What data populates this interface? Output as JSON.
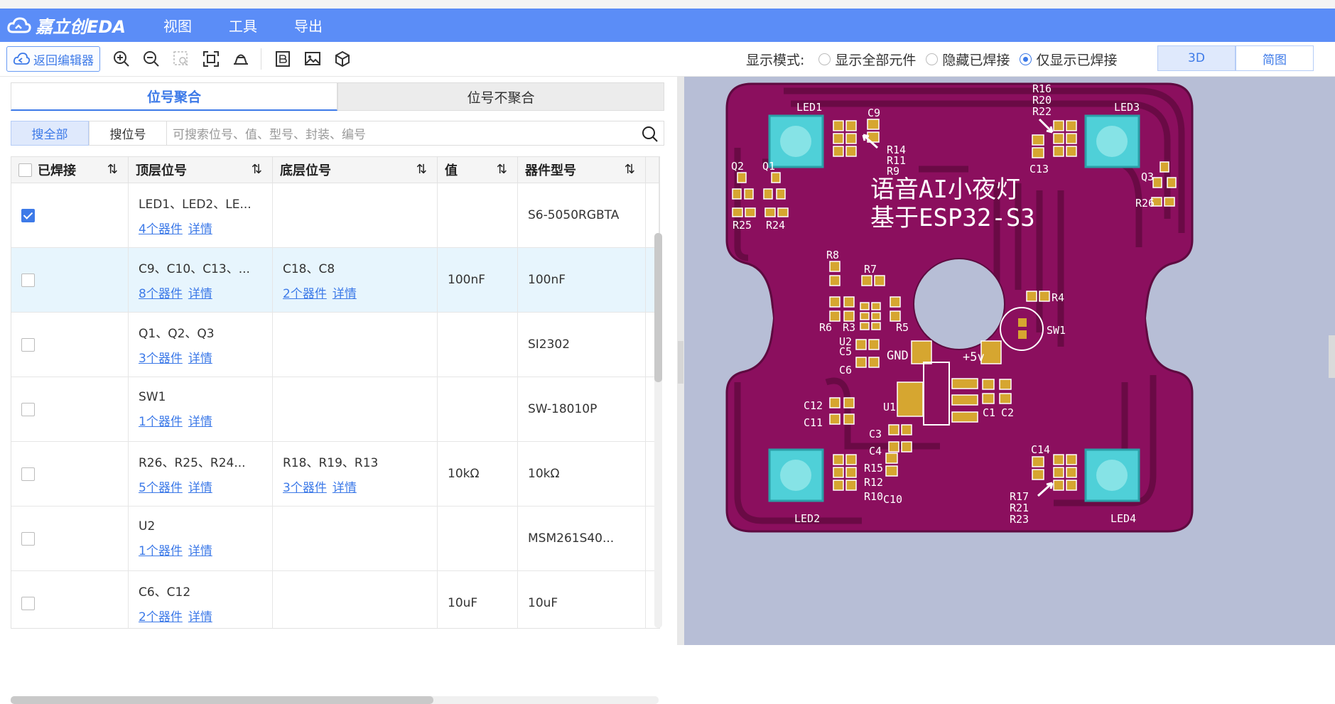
{
  "app": {
    "logo_text": "嘉立创EDA",
    "menu": [
      "视图",
      "工具",
      "导出"
    ]
  },
  "toolbar": {
    "back_label": "返回编辑器",
    "display_mode_label": "显示模式:",
    "modes": [
      "显示全部元件",
      "隐藏已焊接",
      "仅显示已焊接"
    ],
    "selected_mode": "仅显示已焊接",
    "view_buttons": [
      "3D",
      "简图"
    ],
    "active_view": "3D"
  },
  "tabs": [
    "位号聚合",
    "位号不聚合"
  ],
  "search": {
    "buttons": [
      "搜全部",
      "搜位号"
    ],
    "placeholder": "可搜索位号、值、型号、封装、编号"
  },
  "table": {
    "headers": [
      "已焊接",
      "顶层位号",
      "底层位号",
      "值",
      "器件型号"
    ],
    "rows": [
      {
        "checked": true,
        "top": "LED1、LED2、LE...",
        "top_count": "4个器件",
        "top_detail": "详情",
        "bottom": "",
        "bottom_count": "",
        "bottom_detail": "",
        "value": "",
        "model": "S6-5050RGBTA"
      },
      {
        "checked": false,
        "top": "C9、C10、C13、...",
        "top_count": "8个器件",
        "top_detail": "详情",
        "bottom": "C18、C8",
        "bottom_count": "2个器件",
        "bottom_detail": "详情",
        "value": "100nF",
        "model": "100nF"
      },
      {
        "checked": false,
        "top": "Q1、Q2、Q3",
        "top_count": "3个器件",
        "top_detail": "详情",
        "bottom": "",
        "bottom_count": "",
        "bottom_detail": "",
        "value": "",
        "model": "SI2302"
      },
      {
        "checked": false,
        "top": "SW1",
        "top_count": "1个器件",
        "top_detail": "详情",
        "bottom": "",
        "bottom_count": "",
        "bottom_detail": "",
        "value": "",
        "model": "SW-18010P"
      },
      {
        "checked": false,
        "top": "R26、R25、R24...",
        "top_count": "5个器件",
        "top_detail": "详情",
        "bottom": "R18、R19、R13",
        "bottom_count": "3个器件",
        "bottom_detail": "详情",
        "value": "10kΩ",
        "model": "10kΩ"
      },
      {
        "checked": false,
        "top": "U2",
        "top_count": "1个器件",
        "top_detail": "详情",
        "bottom": "",
        "bottom_count": "",
        "bottom_detail": "",
        "value": "",
        "model": "MSM261S40..."
      },
      {
        "checked": false,
        "top": "C6、C12",
        "top_count": "2个器件",
        "top_detail": "详情",
        "bottom": "",
        "bottom_count": "",
        "bottom_detail": "",
        "value": "10uF",
        "model": "10uF"
      }
    ]
  },
  "pcb": {
    "title_line1": "语音AI小夜灯",
    "title_line2": "基于ESP32-S3",
    "labels": [
      "LED1",
      "LED2",
      "LED3",
      "LED4",
      "C9",
      "R16",
      "R20",
      "R22",
      "R14",
      "R11",
      "R9",
      "C13",
      "Q1",
      "Q2",
      "Q3",
      "R25",
      "R24",
      "R26",
      "R8",
      "R7",
      "R6",
      "R3",
      "R5",
      "R4",
      "SW1",
      "U2",
      "C5",
      "C6",
      "GND",
      "+5v",
      "C12",
      "C11",
      "U1",
      "C1",
      "C2",
      "C3",
      "C4",
      "C14",
      "R15",
      "R12",
      "R10",
      "C10",
      "R17",
      "R21",
      "R23"
    ],
    "colors": {
      "board": "#8b0f5e",
      "pad": "#d6a630",
      "led": "#7fe0e0",
      "silk": "#ffffff",
      "background": "#b7bed6"
    }
  }
}
